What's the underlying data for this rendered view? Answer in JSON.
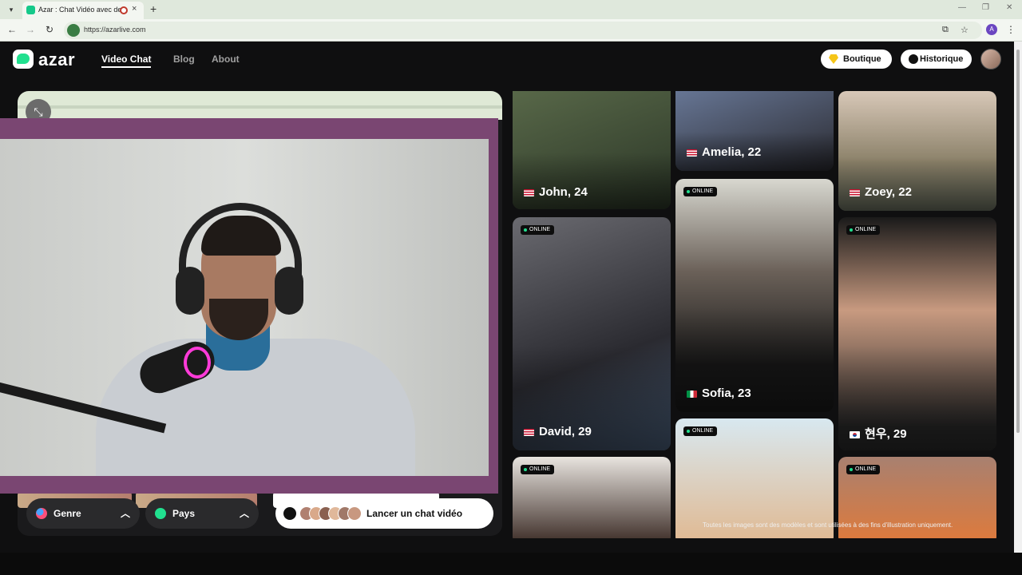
{
  "browser": {
    "tab_title": "Azar : Chat Vidéo avec de n",
    "tab_close": "×",
    "new_tab": "+",
    "url": "https://azarlive.com",
    "profile_initial": "A"
  },
  "header": {
    "logo_text": "azar",
    "nav": [
      {
        "label": "Video Chat",
        "active": true
      },
      {
        "label": "Blog",
        "active": false
      },
      {
        "label": "About",
        "active": false
      }
    ],
    "boutique_label": "Boutique",
    "historique_label": "Historique"
  },
  "controls": {
    "genre_label": "Genre",
    "pays_label": "Pays",
    "start_label": "Lancer un chat vidéo"
  },
  "profiles": [
    {
      "name": "John, 24",
      "flag": "us",
      "online": false
    },
    {
      "name": "Amelia, 22",
      "flag": "us",
      "online": false
    },
    {
      "name": "Zoey, 22",
      "flag": "us",
      "online": false
    },
    {
      "name": "David, 29",
      "flag": "us",
      "online": true
    },
    {
      "name": "Sofia, 23",
      "flag": "it",
      "online": true
    },
    {
      "name": "현우, 29",
      "flag": "kr",
      "online": true
    },
    {
      "name": "",
      "flag": "",
      "online": true
    },
    {
      "name": "",
      "flag": "",
      "online": true
    },
    {
      "name": "",
      "flag": "",
      "online": true
    }
  ],
  "online_label": "ONLINE",
  "disclaimer": "Toutes les images sont des modèles et sont utilisées à des fins d'illustration uniquement.",
  "colors": {
    "brand_green": "#21e08f",
    "background": "#0f0f10",
    "mic_ring": "#ff3bd9"
  }
}
